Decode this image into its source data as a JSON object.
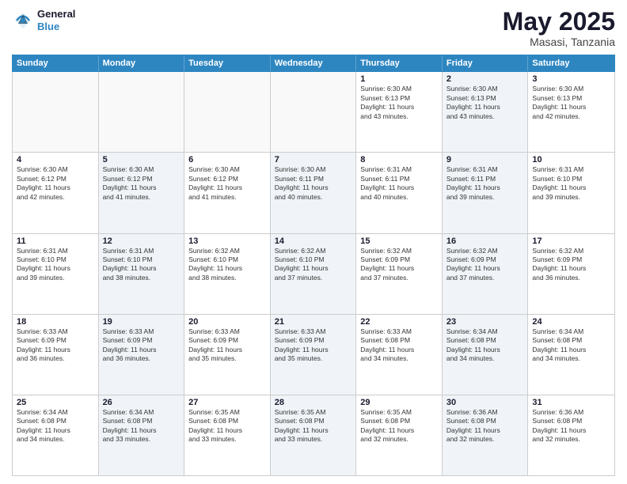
{
  "header": {
    "logo_line1": "General",
    "logo_line2": "Blue",
    "month_year": "May 2025",
    "location": "Masasi, Tanzania"
  },
  "days_of_week": [
    "Sunday",
    "Monday",
    "Tuesday",
    "Wednesday",
    "Thursday",
    "Friday",
    "Saturday"
  ],
  "weeks": [
    [
      {
        "day": "",
        "text": "",
        "shaded": false,
        "empty": true
      },
      {
        "day": "",
        "text": "",
        "shaded": false,
        "empty": true
      },
      {
        "day": "",
        "text": "",
        "shaded": false,
        "empty": true
      },
      {
        "day": "",
        "text": "",
        "shaded": false,
        "empty": true
      },
      {
        "day": "1",
        "text": "Sunrise: 6:30 AM\nSunset: 6:13 PM\nDaylight: 11 hours\nand 43 minutes.",
        "shaded": false,
        "empty": false
      },
      {
        "day": "2",
        "text": "Sunrise: 6:30 AM\nSunset: 6:13 PM\nDaylight: 11 hours\nand 43 minutes.",
        "shaded": true,
        "empty": false
      },
      {
        "day": "3",
        "text": "Sunrise: 6:30 AM\nSunset: 6:13 PM\nDaylight: 11 hours\nand 42 minutes.",
        "shaded": false,
        "empty": false
      }
    ],
    [
      {
        "day": "4",
        "text": "Sunrise: 6:30 AM\nSunset: 6:12 PM\nDaylight: 11 hours\nand 42 minutes.",
        "shaded": false,
        "empty": false
      },
      {
        "day": "5",
        "text": "Sunrise: 6:30 AM\nSunset: 6:12 PM\nDaylight: 11 hours\nand 41 minutes.",
        "shaded": true,
        "empty": false
      },
      {
        "day": "6",
        "text": "Sunrise: 6:30 AM\nSunset: 6:12 PM\nDaylight: 11 hours\nand 41 minutes.",
        "shaded": false,
        "empty": false
      },
      {
        "day": "7",
        "text": "Sunrise: 6:30 AM\nSunset: 6:11 PM\nDaylight: 11 hours\nand 40 minutes.",
        "shaded": true,
        "empty": false
      },
      {
        "day": "8",
        "text": "Sunrise: 6:31 AM\nSunset: 6:11 PM\nDaylight: 11 hours\nand 40 minutes.",
        "shaded": false,
        "empty": false
      },
      {
        "day": "9",
        "text": "Sunrise: 6:31 AM\nSunset: 6:11 PM\nDaylight: 11 hours\nand 39 minutes.",
        "shaded": true,
        "empty": false
      },
      {
        "day": "10",
        "text": "Sunrise: 6:31 AM\nSunset: 6:10 PM\nDaylight: 11 hours\nand 39 minutes.",
        "shaded": false,
        "empty": false
      }
    ],
    [
      {
        "day": "11",
        "text": "Sunrise: 6:31 AM\nSunset: 6:10 PM\nDaylight: 11 hours\nand 39 minutes.",
        "shaded": false,
        "empty": false
      },
      {
        "day": "12",
        "text": "Sunrise: 6:31 AM\nSunset: 6:10 PM\nDaylight: 11 hours\nand 38 minutes.",
        "shaded": true,
        "empty": false
      },
      {
        "day": "13",
        "text": "Sunrise: 6:32 AM\nSunset: 6:10 PM\nDaylight: 11 hours\nand 38 minutes.",
        "shaded": false,
        "empty": false
      },
      {
        "day": "14",
        "text": "Sunrise: 6:32 AM\nSunset: 6:10 PM\nDaylight: 11 hours\nand 37 minutes.",
        "shaded": true,
        "empty": false
      },
      {
        "day": "15",
        "text": "Sunrise: 6:32 AM\nSunset: 6:09 PM\nDaylight: 11 hours\nand 37 minutes.",
        "shaded": false,
        "empty": false
      },
      {
        "day": "16",
        "text": "Sunrise: 6:32 AM\nSunset: 6:09 PM\nDaylight: 11 hours\nand 37 minutes.",
        "shaded": true,
        "empty": false
      },
      {
        "day": "17",
        "text": "Sunrise: 6:32 AM\nSunset: 6:09 PM\nDaylight: 11 hours\nand 36 minutes.",
        "shaded": false,
        "empty": false
      }
    ],
    [
      {
        "day": "18",
        "text": "Sunrise: 6:33 AM\nSunset: 6:09 PM\nDaylight: 11 hours\nand 36 minutes.",
        "shaded": false,
        "empty": false
      },
      {
        "day": "19",
        "text": "Sunrise: 6:33 AM\nSunset: 6:09 PM\nDaylight: 11 hours\nand 36 minutes.",
        "shaded": true,
        "empty": false
      },
      {
        "day": "20",
        "text": "Sunrise: 6:33 AM\nSunset: 6:09 PM\nDaylight: 11 hours\nand 35 minutes.",
        "shaded": false,
        "empty": false
      },
      {
        "day": "21",
        "text": "Sunrise: 6:33 AM\nSunset: 6:09 PM\nDaylight: 11 hours\nand 35 minutes.",
        "shaded": true,
        "empty": false
      },
      {
        "day": "22",
        "text": "Sunrise: 6:33 AM\nSunset: 6:08 PM\nDaylight: 11 hours\nand 34 minutes.",
        "shaded": false,
        "empty": false
      },
      {
        "day": "23",
        "text": "Sunrise: 6:34 AM\nSunset: 6:08 PM\nDaylight: 11 hours\nand 34 minutes.",
        "shaded": true,
        "empty": false
      },
      {
        "day": "24",
        "text": "Sunrise: 6:34 AM\nSunset: 6:08 PM\nDaylight: 11 hours\nand 34 minutes.",
        "shaded": false,
        "empty": false
      }
    ],
    [
      {
        "day": "25",
        "text": "Sunrise: 6:34 AM\nSunset: 6:08 PM\nDaylight: 11 hours\nand 34 minutes.",
        "shaded": false,
        "empty": false
      },
      {
        "day": "26",
        "text": "Sunrise: 6:34 AM\nSunset: 6:08 PM\nDaylight: 11 hours\nand 33 minutes.",
        "shaded": true,
        "empty": false
      },
      {
        "day": "27",
        "text": "Sunrise: 6:35 AM\nSunset: 6:08 PM\nDaylight: 11 hours\nand 33 minutes.",
        "shaded": false,
        "empty": false
      },
      {
        "day": "28",
        "text": "Sunrise: 6:35 AM\nSunset: 6:08 PM\nDaylight: 11 hours\nand 33 minutes.",
        "shaded": true,
        "empty": false
      },
      {
        "day": "29",
        "text": "Sunrise: 6:35 AM\nSunset: 6:08 PM\nDaylight: 11 hours\nand 32 minutes.",
        "shaded": false,
        "empty": false
      },
      {
        "day": "30",
        "text": "Sunrise: 6:36 AM\nSunset: 6:08 PM\nDaylight: 11 hours\nand 32 minutes.",
        "shaded": true,
        "empty": false
      },
      {
        "day": "31",
        "text": "Sunrise: 6:36 AM\nSunset: 6:08 PM\nDaylight: 11 hours\nand 32 minutes.",
        "shaded": false,
        "empty": false
      }
    ]
  ]
}
